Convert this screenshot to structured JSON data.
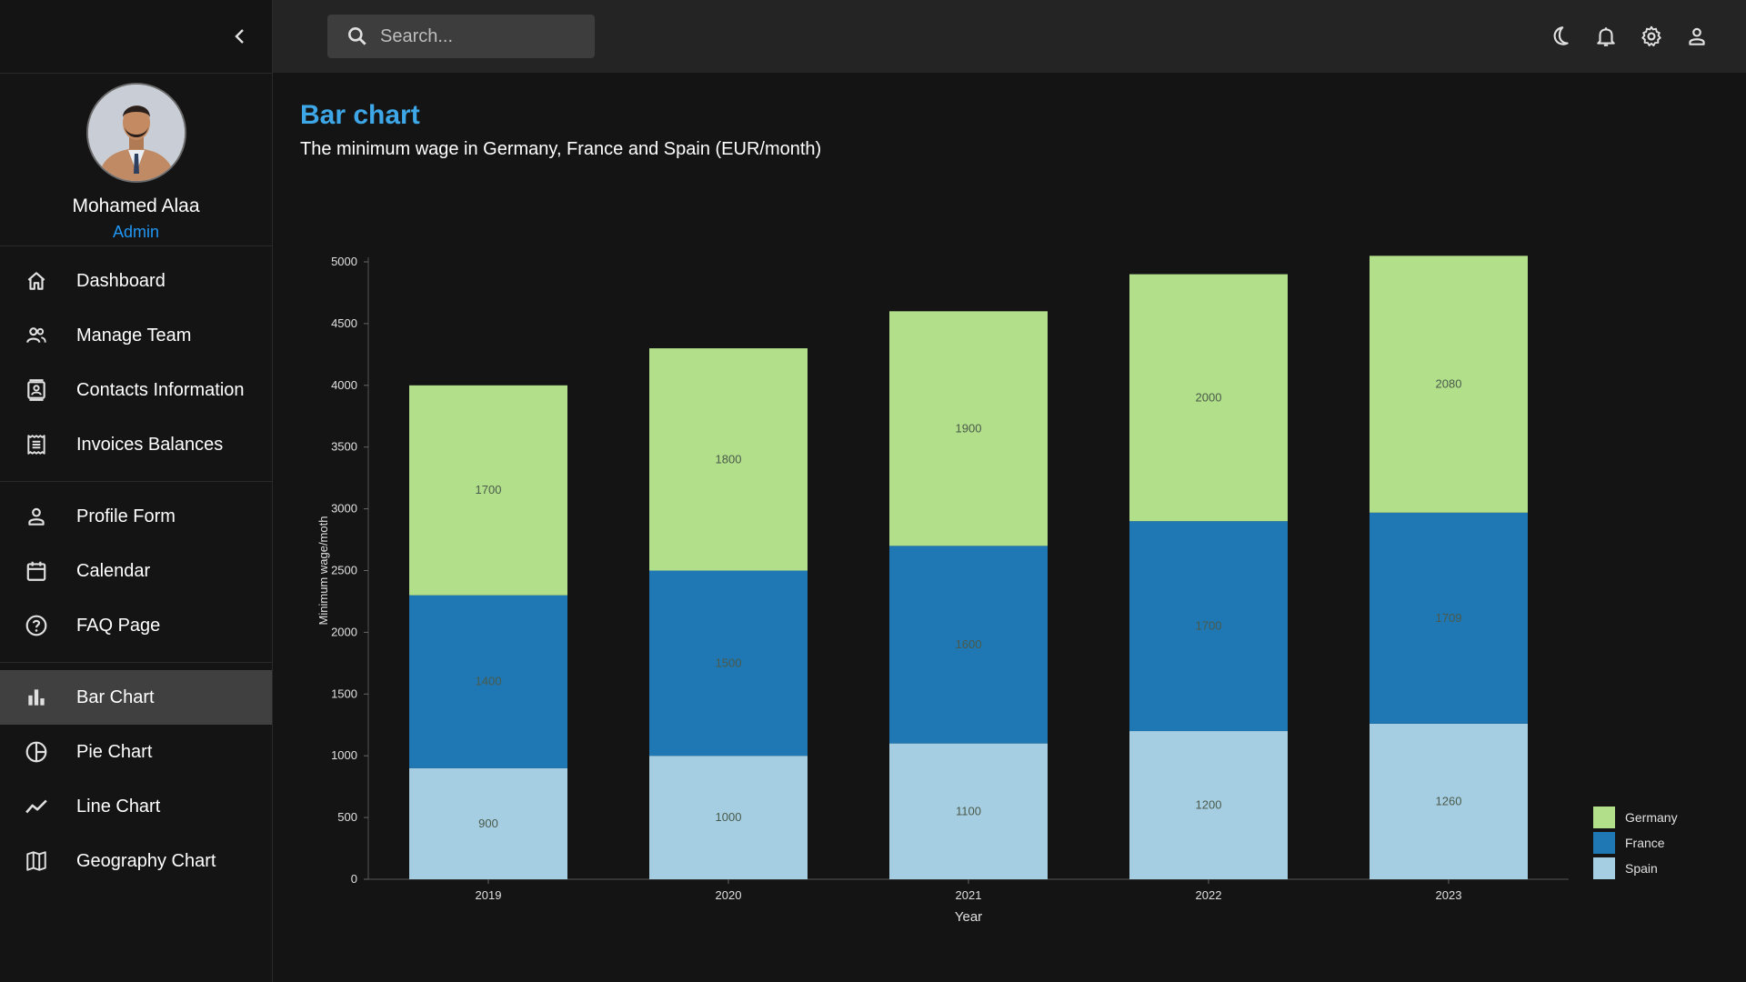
{
  "sidebar": {
    "profile": {
      "name": "Mohamed Alaa",
      "role": "Admin"
    },
    "groups": [
      [
        {
          "label": "Dashboard",
          "icon": "home-icon"
        },
        {
          "label": "Manage Team",
          "icon": "people-icon"
        },
        {
          "label": "Contacts Information",
          "icon": "contacts-icon"
        },
        {
          "label": "Invoices Balances",
          "icon": "receipt-icon"
        }
      ],
      [
        {
          "label": "Profile Form",
          "icon": "person-icon"
        },
        {
          "label": "Calendar",
          "icon": "calendar-icon"
        },
        {
          "label": "FAQ Page",
          "icon": "help-icon"
        }
      ],
      [
        {
          "label": "Bar Chart",
          "icon": "bar-chart-icon",
          "active": true
        },
        {
          "label": "Pie Chart",
          "icon": "pie-chart-icon"
        },
        {
          "label": "Line Chart",
          "icon": "line-chart-icon"
        },
        {
          "label": "Geography Chart",
          "icon": "map-icon"
        }
      ]
    ]
  },
  "topbar": {
    "search_placeholder": "Search...",
    "icons": [
      "dark-mode-icon",
      "notifications-icon",
      "settings-icon",
      "account-icon"
    ]
  },
  "main": {
    "title": "Bar chart",
    "subtitle": "The minimum wage in Germany, France and Spain (EUR/month)"
  },
  "colors": {
    "accent_title": "#3da7e8",
    "role": "#2196f3",
    "germany": "#b2df8a",
    "france": "#1f78b4",
    "spain": "#a6cee3",
    "active_nav": "#404040"
  },
  "chart_data": {
    "type": "bar",
    "stacked": true,
    "categories": [
      "2019",
      "2020",
      "2021",
      "2022",
      "2023"
    ],
    "series": [
      {
        "name": "Spain",
        "color": "#a6cee3",
        "values": [
          900,
          1000,
          1100,
          1200,
          1260
        ]
      },
      {
        "name": "France",
        "color": "#1f78b4",
        "values": [
          1400,
          1500,
          1600,
          1700,
          1709
        ]
      },
      {
        "name": "Germany",
        "color": "#b2df8a",
        "values": [
          1700,
          1800,
          1900,
          2000,
          2080
        ]
      }
    ],
    "xlabel": "Year",
    "ylabel": "Minimum wage/moth",
    "ylim": [
      0,
      5000
    ],
    "yticks": [
      "0",
      "500",
      "1000",
      "1500",
      "2000",
      "2500",
      "3000",
      "3500",
      "4000",
      "4500",
      "5000"
    ],
    "legend": {
      "position": "bottom-right",
      "order": [
        "Germany",
        "France",
        "Spain"
      ]
    },
    "grid": false
  }
}
